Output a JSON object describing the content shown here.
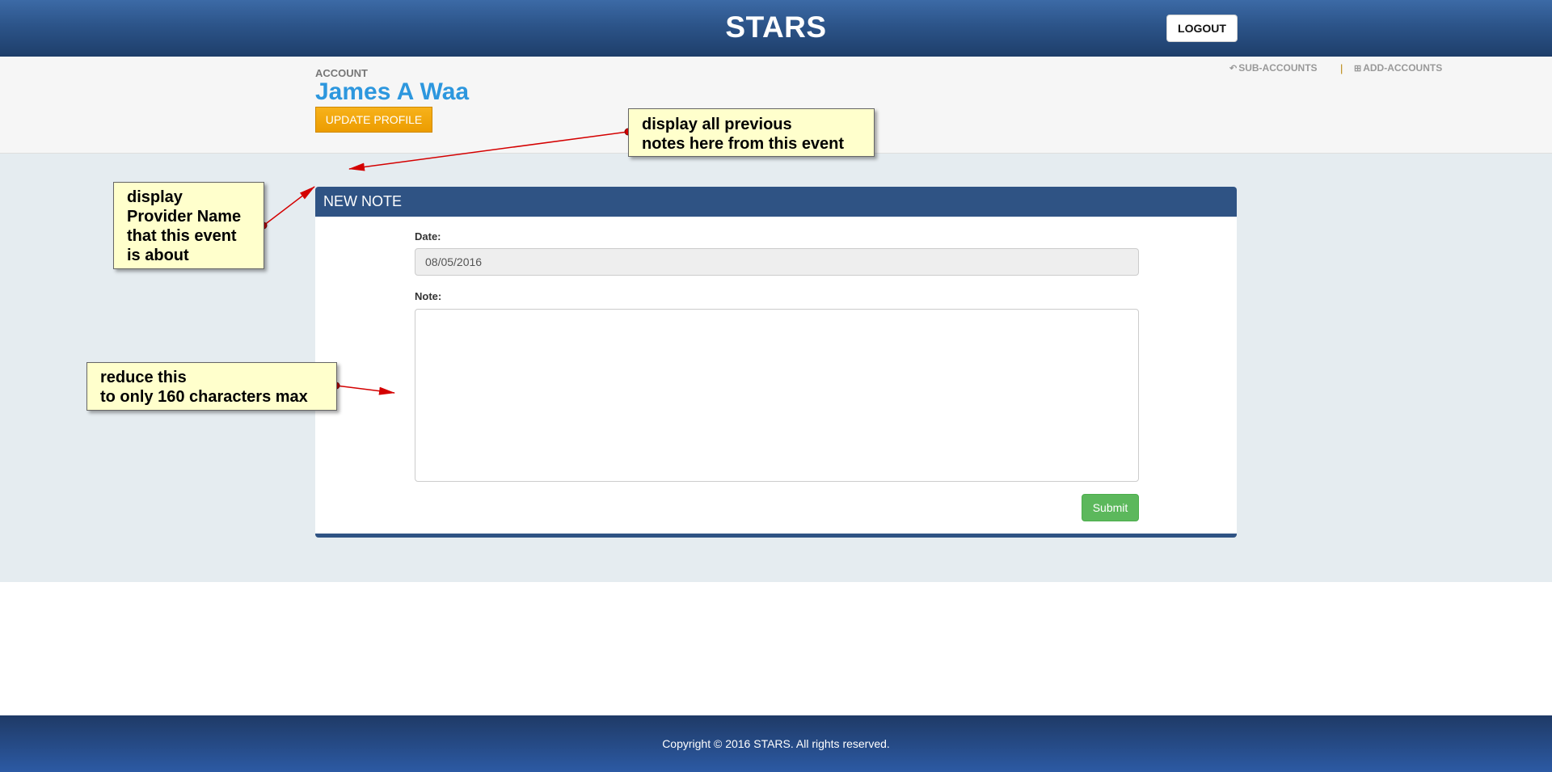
{
  "header": {
    "brand": "STARS",
    "logout_label": "LOGOUT"
  },
  "account": {
    "label": "ACCOUNT",
    "name": "James A Waa",
    "update_profile_label": "UPDATE PROFILE",
    "nav": {
      "sub_accounts": "SUB-ACCOUNTS",
      "separator": "|",
      "add_accounts": "ADD-ACCOUNTS"
    }
  },
  "note_form": {
    "title": "NEW NOTE",
    "date_label": "Date:",
    "date_value": "08/05/2016",
    "note_label": "Note:",
    "note_value": "",
    "submit_label": "Submit"
  },
  "annotations": {
    "previous_notes": [
      "display all previous",
      "notes here from this event"
    ],
    "provider_name": [
      "display",
      "Provider Name",
      "that this event",
      "is about"
    ],
    "char_limit": [
      "reduce this",
      "to only 160 characters max"
    ]
  },
  "footer": {
    "copyright": "Copyright © 2016 STARS. All rights reserved."
  },
  "colors": {
    "header_blue": "#2c5489",
    "panel_blue": "#2f5384",
    "account_name": "#2d97de",
    "update_button": "#f0a30a",
    "submit_button": "#5cb85c",
    "callout_bg": "#ffffcc",
    "arrow_red": "#d40000"
  },
  "icons": {
    "sub_accounts": "reply-icon",
    "add_accounts": "plus-square-icon"
  }
}
